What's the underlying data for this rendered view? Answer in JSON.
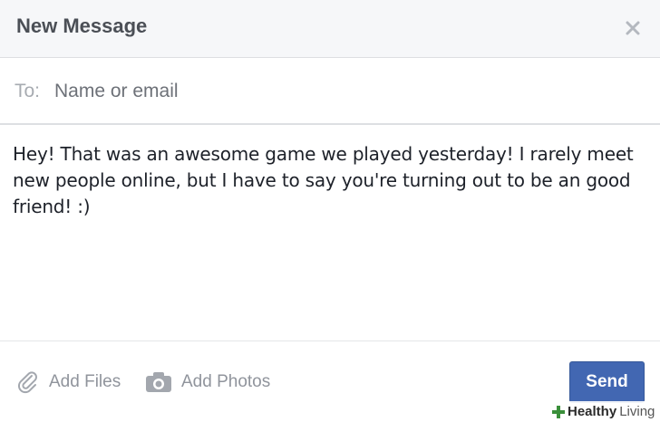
{
  "dialog": {
    "title": "New Message",
    "close_glyph": "×"
  },
  "recipient": {
    "label": "To:",
    "placeholder": "Name or email",
    "value": ""
  },
  "message": {
    "text": "Hey! That was an awesome game we played yesterday! I rarely meet new people online, but I have to say you're turning out to be an good friend! :)"
  },
  "footer": {
    "add_files_label": "Add Files",
    "add_photos_label": "Add Photos",
    "send_label": "Send"
  },
  "watermark": {
    "healthy": "Healthy",
    "living": "Living"
  },
  "colors": {
    "accent": "#4267b2",
    "header_bg": "#f6f7f9",
    "muted_text": "#90949c"
  },
  "icons": {
    "close": "close-icon",
    "attach": "paperclip-icon",
    "photo": "camera-icon",
    "watermark": "cross-icon"
  }
}
